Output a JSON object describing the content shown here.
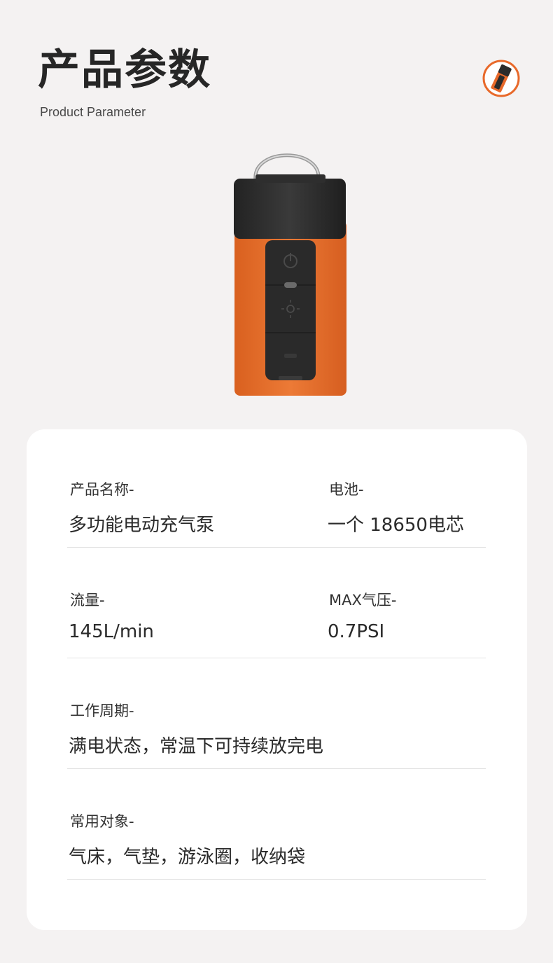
{
  "header": {
    "title": "产品参数",
    "subtitle": "Product Parameter",
    "badge_icon": "pump-icon"
  },
  "colors": {
    "accent": "#e8692a",
    "background": "#f4f2f2",
    "card": "#ffffff",
    "device_body": "#e26a2c",
    "device_cap": "#2b2b2b"
  },
  "params": [
    {
      "left": {
        "label": "产品名称-",
        "value": "多功能电动充气泵"
      },
      "right": {
        "label": "电池-",
        "value": "一个 18650电芯"
      }
    },
    {
      "left": {
        "label": "流量-",
        "value": "145L/min"
      },
      "right": {
        "label": "MAX气压-",
        "value": "0.7PSI"
      }
    },
    {
      "left": {
        "label": "工作周期-",
        "value": "满电状态，常温下可持续放完电"
      }
    },
    {
      "left": {
        "label": "常用对象-",
        "value": "气床，气垫，游泳圈，收纳袋"
      }
    }
  ]
}
